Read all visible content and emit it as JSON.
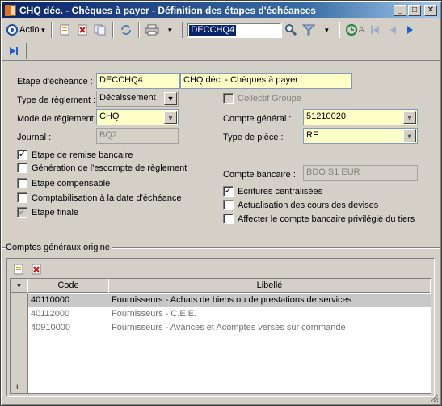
{
  "window": {
    "title": "CHQ déc. - Chèques à payer - Définition des étapes d'échéances",
    "minimize": "_",
    "maximize": "□",
    "close": "✕"
  },
  "toolbar": {
    "action_label": "Actio",
    "search_value": "DECCHQ4",
    "prefix_a": "A"
  },
  "form": {
    "etape_label": "Etape d'échéance :",
    "etape_code": "DECCHQ4",
    "etape_desc": "CHQ déc. - Chèques à payer",
    "type_reglement_label": "Type de règlement :",
    "type_reglement_value": "Décaissement",
    "collectif_groupe_label": "Collectif Groupe",
    "mode_reglement_label": "Mode de règlement :",
    "mode_reglement_value": "CHQ",
    "compte_general_label": "Compte général :",
    "compte_general_value": "51210020",
    "journal_label": "Journal :",
    "journal_value": "BQ2",
    "type_piece_label": "Type de pièce :",
    "type_piece_value": "RF",
    "compte_bancaire_label": "Compte bancaire :",
    "compte_bancaire_value": "BDO S1 EUR"
  },
  "checkboxes": {
    "remise_bancaire": {
      "label": "Etape de remise bancaire",
      "checked": true
    },
    "generation_escompte": {
      "label": "Génération de l'escompte de règlement",
      "checked": false
    },
    "etape_compensable": {
      "label": "Etape compensable",
      "checked": false
    },
    "comptabilisation": {
      "label": "Comptabilisation à la date d'échéance",
      "checked": false
    },
    "etape_finale": {
      "label": "Etape finale",
      "checked": true
    },
    "ecritures_centralisees": {
      "label": "Ecritures centralisées",
      "checked": true
    },
    "actualisation_cours": {
      "label": "Actualisation des cours des devises",
      "checked": false
    },
    "affecter_compte": {
      "label": "Affecter le compte bancaire privilégié du tiers",
      "checked": false
    }
  },
  "comptes": {
    "group_title": "Comptes généraux origine",
    "col_code": "Code",
    "col_libelle": "Libellé",
    "rows": [
      {
        "code": "40110000",
        "libelle": "Fournisseurs - Achats de biens ou de prestations de services"
      },
      {
        "code": "40112000",
        "libelle": "Fournisseurs - C.E.E."
      },
      {
        "code": "40910000",
        "libelle": "Fournisseurs - Avances et Acomptes versés sur commande"
      }
    ],
    "add_marker": "+"
  }
}
